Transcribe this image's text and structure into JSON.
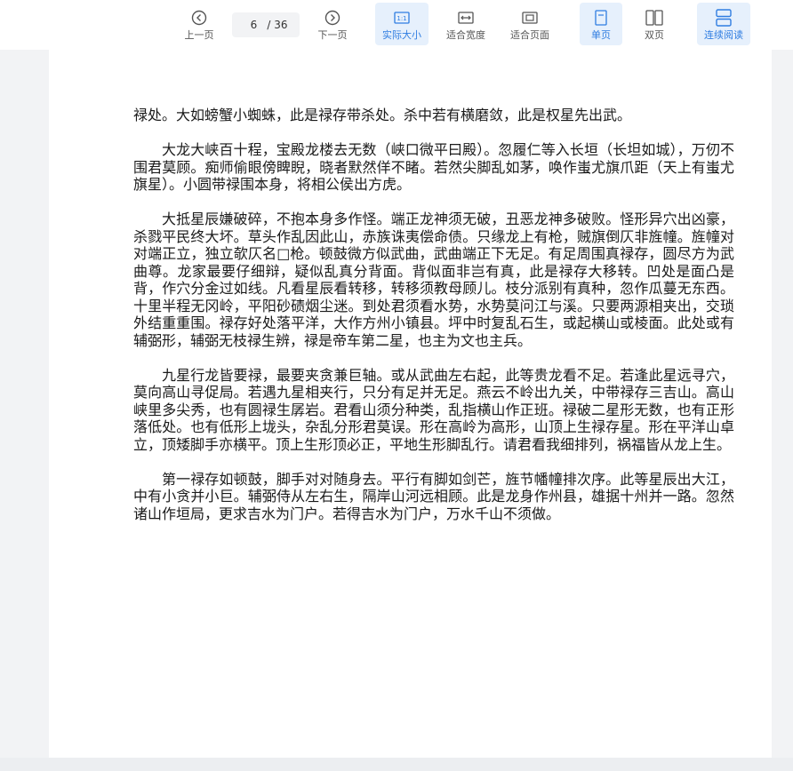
{
  "toolbar": {
    "prev_label": "上一页",
    "page_current": "6",
    "page_total": "/ 36",
    "next_label": "下一页",
    "actual_size_label": "实际大小",
    "fit_width_label": "适合宽度",
    "fit_page_label": "适合页面",
    "single_page_label": "单页",
    "double_page_label": "双页",
    "continuous_label": "连续阅读",
    "accent_color": "#2f7de1"
  },
  "document": {
    "paragraphs": [
      "禄处。大如螃蟹小蜘蛛，此是禄存带杀处。杀中若有横磨敛，此是权星先出武。",
      "大龙大峡百十程，宝殿龙楼去无数（峡口微平曰殿）。忽履仁等入长垣（长坦如城），万仞不围君莫顾。痴师偷眼傍睥睨，晓者默然佯不睹。若然尖脚乱如茅，唤作蚩尤旗爪距（天上有蚩尤旗星）。小圆带禄围本身，将相公侯出方虎。",
      "大抵星辰嫌破碎，不抱本身多作怪。端正龙神须无破，丑恶龙神多破败。怪形异穴出凶豪，杀戮平民终大坏。草头作乱因此山，赤族诛夷偿命债。只缘龙上有枪，贼旗倒仄非旌幢。旌幢对对端正立，独立欹仄名□枪。顿鼓微方似武曲，武曲端正下无足。有足周围真禄存，圆尽方为武曲尊。龙家最要仔细辩，疑似乱真分背面。背似面非岂有真，此是禄存大移转。凹处是面凸是背，作穴分金过如线。凡看星辰看转移，转移须教母顾儿。枝分派别有真种，忽作瓜蔓无东西。十里半程无冈岭，平阳砂碛烟尘迷。到处君须看水势，水势莫问江与溪。只要两源相夹出，交琐外结重重围。禄存好处落平洋，大作方州小镇县。坪中时复乱石生，或起横山或棱面。此处或有辅弼形，辅弼无枝禄生辨，禄是帝车第二星，也主为文也主兵。",
      "九星行龙皆要禄，最要夹贪兼巨轴。或从武曲左右起，此等贵龙看不足。若逢此星远寻穴，莫向高山寻促局。若遇九星相夹行，只分有足并无足。燕云不岭出九关，中带禄存三吉山。高山峡里多尖秀，也有圆禄生孱岩。君看山须分种类，乱指横山作正班。禄破二星形无数，也有正形落低处。也有低形上垅头，杂乱分形君莫误。形在高岭为高形，山顶上生禄存星。形在平洋山卓立，顶矮脚手亦横平。顶上生形顶必正，平地生形脚乱行。请君看我细排列，祸福皆从龙上生。",
      "第一禄存如顿鼓，脚手对对随身去。平行有脚如剑芒，旌节幡幢排次序。此等星辰出大江，中有小贪并小巨。辅弼侍从左右生，隔岸山河远相顾。此是龙身作州县，雄据十州并一路。忽然诸山作垣局，更求吉水为门户。若得吉水为门户，万水千山不须做。"
    ]
  }
}
